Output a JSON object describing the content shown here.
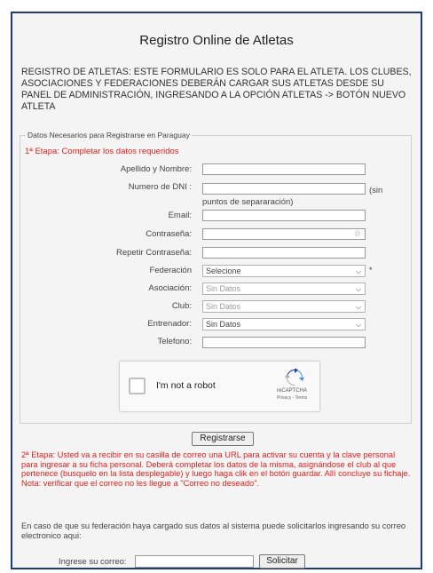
{
  "page": {
    "title": "Registro Online de Atletas",
    "notice": "REGISTRO DE ATLETAS: ESTE FORMULARIO ES SOLO PARA EL ATLETA. LOS CLUBES, ASOCIACIONES Y FEDERACIONES DEBERÁN CARGAR SUS ATLETAS DESDE SU PANEL DE ADMINISTRACIÓN, INGRESANDO A LA OPCIÓN ATLETAS -> BOTÓN NUEVO ATLETA"
  },
  "form": {
    "legend": "Datos Necesarios para Registrarse en Paraguay",
    "stage1": "1ª Etapa: Completar los datos  requeridos",
    "labels": {
      "name": "Apellido y Nombre:",
      "dni": "Numero de DNI :",
      "email": "Email:",
      "password": "Contraseña:",
      "repeat_password": "Repetir Contraseña:",
      "federation": "Federación",
      "association": "Asociación:",
      "club": "Club:",
      "coach": "Entrenador:",
      "phone": "Telefono:"
    },
    "dni_hint_1": "(sin",
    "dni_hint_2": "puntos de separaración)",
    "required_mark": "*",
    "selects": {
      "federation": "Selecione",
      "association": "Sin Datos",
      "club": "Sin Datos",
      "coach": "Sin Datos"
    }
  },
  "captcha": {
    "label": "I'm not a robot",
    "brand": "reCAPTCHA",
    "links": "Privacy - Terms"
  },
  "register_button": "Registrarse",
  "stage2": {
    "text": "2ª Etapa: Usted va a recibir en su casilla de correo una URL para activar su cuenta y la clave personal para ingresar a su ficha personal. Deberá completar los datos  de la misma, asignándose el club al que pertenece (busquelo en la lista desplegable)  y luego haga clik en el botón guardar. Allí concluye su fichaje.",
    "note": "Nota: verificar que el correo no les llegue a \"Correo no deseado\"."
  },
  "recover": {
    "text": "En caso de que su federación haya cargado sus datos al sistema puede solicitarlos ingresando su correo electronico aqui:",
    "email_label": "Ingrese su correo:",
    "button": "Solicitar"
  }
}
